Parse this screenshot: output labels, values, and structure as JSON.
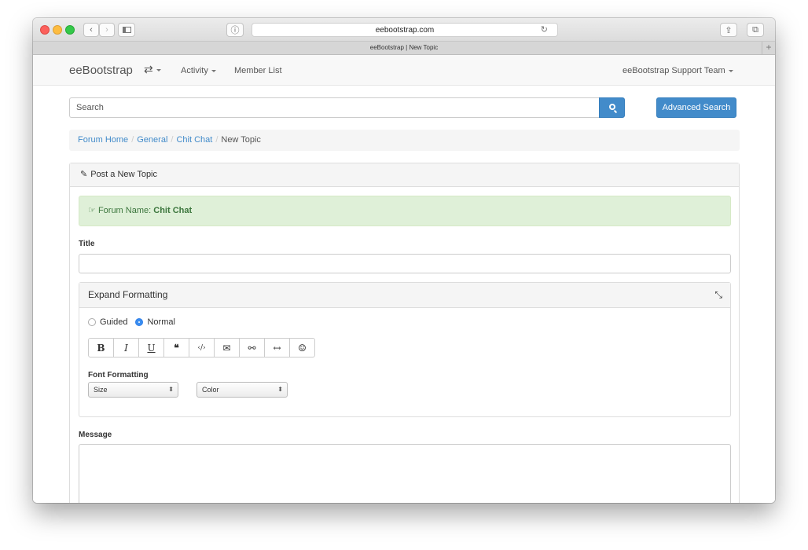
{
  "browser": {
    "url": "eebootstrap.com",
    "tab_title": "eeBootstrap | New Topic",
    "back_glyph": "‹",
    "forward_glyph": "›",
    "info_glyph": "ⓘ",
    "reload_glyph": "↻",
    "share_glyph": "⇪",
    "tabs_glyph": "⧉",
    "newtab_glyph": "+"
  },
  "navbar": {
    "brand": "eeBootstrap",
    "switch_glyph": "⇄",
    "activity": "Activity",
    "member_list": "Member List",
    "user_menu": "eeBootstrap Support Team"
  },
  "search": {
    "placeholder": "Search",
    "advanced_label": "Advanced Search"
  },
  "breadcrumb": {
    "items": [
      "Forum Home",
      "General",
      "Chit Chat"
    ],
    "current": "New Topic",
    "separator": "/"
  },
  "panel": {
    "pencil_glyph": "✎",
    "heading": "Post a New Topic",
    "alert_glyph": "☞",
    "alert_prefix": "Forum Name:",
    "alert_forum": "Chit Chat",
    "title_label": "Title",
    "formatting": {
      "heading": "Expand Formatting",
      "compress_glyph": "⤡",
      "modes": [
        "Guided",
        "Normal"
      ],
      "selected_mode": "Normal",
      "buttons": [
        {
          "name": "bold-button",
          "glyph": "B"
        },
        {
          "name": "italic-button",
          "glyph": "I"
        },
        {
          "name": "underline-button",
          "glyph": "U"
        },
        {
          "name": "quote-button",
          "glyph": "❝"
        },
        {
          "name": "code-button",
          "glyph": "‹/›"
        },
        {
          "name": "email-button",
          "glyph": "✉"
        },
        {
          "name": "link-button",
          "glyph": "⚯"
        },
        {
          "name": "horizontal-rule-button",
          "glyph": "↔"
        },
        {
          "name": "emoji-button",
          "glyph": "☺"
        }
      ],
      "font_formatting_label": "Font Formatting",
      "size_select": "Size",
      "color_select": "Color",
      "select_arrows": "⬍"
    },
    "message_label": "Message"
  },
  "colors": {
    "primary": "#428bca",
    "success_bg": "#dff0d8",
    "success_text": "#3c763d"
  }
}
